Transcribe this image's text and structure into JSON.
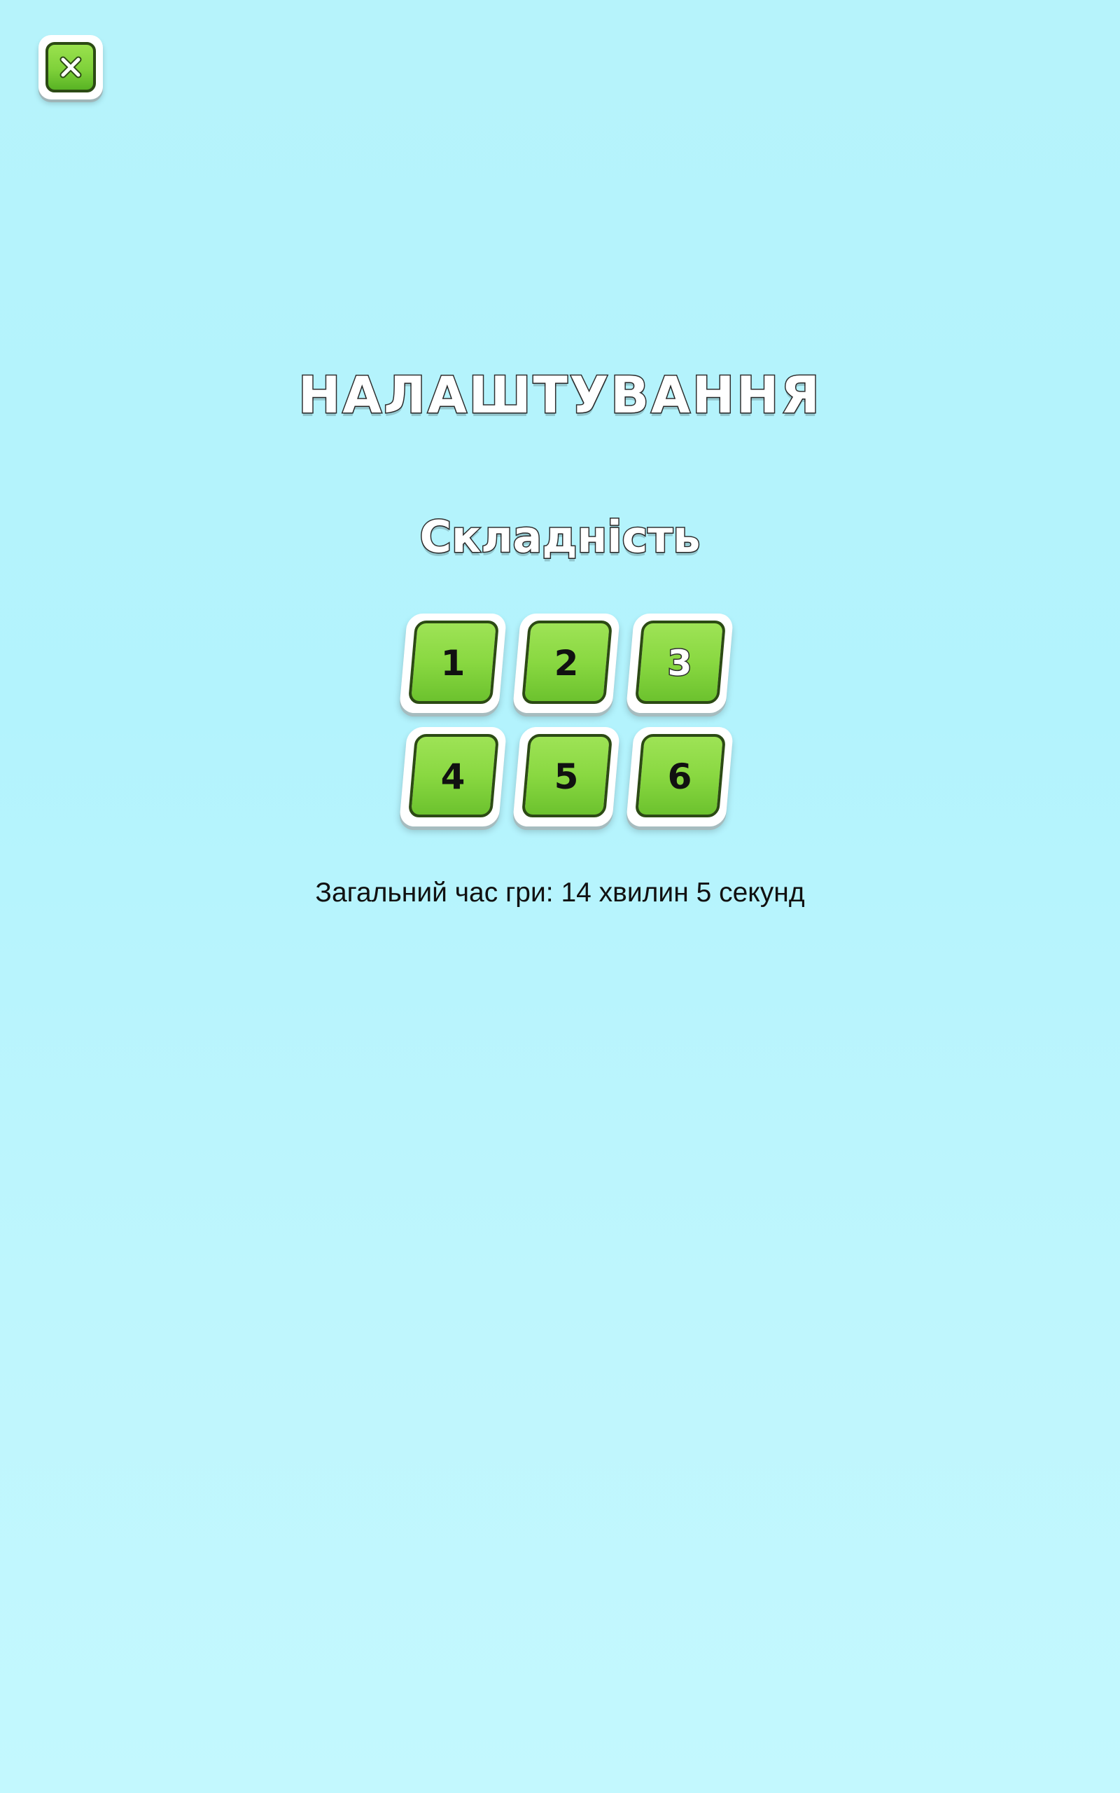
{
  "close_button": {
    "icon": "close-icon"
  },
  "title": "НАЛАШТУВАННЯ",
  "difficulty": {
    "label": "Складність",
    "selected": "3",
    "levels": [
      "1",
      "2",
      "3",
      "4",
      "5",
      "6"
    ]
  },
  "stats": {
    "total_play_time": "Загальний час гри: 14 хвилин 5 секунд"
  },
  "colors": {
    "background": "#b6f3fb",
    "button_green": "#89d841",
    "button_outline": "#2c4a14",
    "text_dark": "#111111",
    "text_light": "#ffffff"
  }
}
